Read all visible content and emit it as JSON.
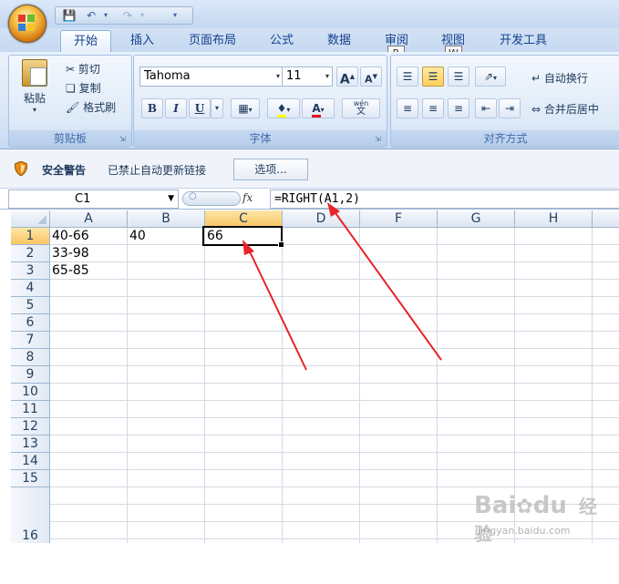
{
  "qat": {
    "save_icon": "save-icon",
    "undo_icon": "undo-icon",
    "redo_icon": "redo-icon",
    "customize_icon": "chevron-down-icon"
  },
  "tabs": [
    {
      "label": "开始",
      "active": true
    },
    {
      "label": "插入"
    },
    {
      "label": "页面布局"
    },
    {
      "label": "公式"
    },
    {
      "label": "数据"
    },
    {
      "label": "审阅",
      "keytip": "R"
    },
    {
      "label": "视图",
      "keytip": "W"
    },
    {
      "label": "开发工具"
    }
  ],
  "ribbon": {
    "clipboard": {
      "paste": "粘贴",
      "cut": "剪切",
      "copy": "复制",
      "format_painter": "格式刷",
      "label": "剪贴板"
    },
    "font": {
      "font_name": "Tahoma",
      "font_size": "11",
      "grow": "A",
      "shrink": "A",
      "bold": "B",
      "italic": "I",
      "underline": "U",
      "font_color_glyph": "A",
      "phonetic_top": "wén",
      "phonetic_bottom": "文",
      "label": "字体"
    },
    "alignment": {
      "wrap": "自动换行",
      "merge": "合并后居中",
      "label": "对齐方式"
    }
  },
  "security": {
    "title": "安全警告",
    "message": "已禁止自动更新链接",
    "options": "选项..."
  },
  "formula_bar": {
    "name_box": "C1",
    "fx": "fx",
    "formula": "=RIGHT(A1,2)"
  },
  "columns": [
    "A",
    "B",
    "C",
    "D",
    "F",
    "G",
    "H"
  ],
  "rows": [
    "1",
    "2",
    "3",
    "4",
    "5",
    "6",
    "7",
    "8",
    "9",
    "10",
    "11",
    "12",
    "13",
    "14",
    "15",
    "16"
  ],
  "cells": {
    "A1": "40-66",
    "A2": "33-98",
    "A3": "65-85",
    "B1": "40",
    "C1": "66"
  },
  "watermark": {
    "brand": "Bai",
    "brand2": "du",
    "brand_cn": "经验",
    "url": "jingyan.baidu.com"
  },
  "colors": {
    "arrow": "#e8232a",
    "selected_header": "#f9c563",
    "ribbon_text": "#15428b"
  }
}
